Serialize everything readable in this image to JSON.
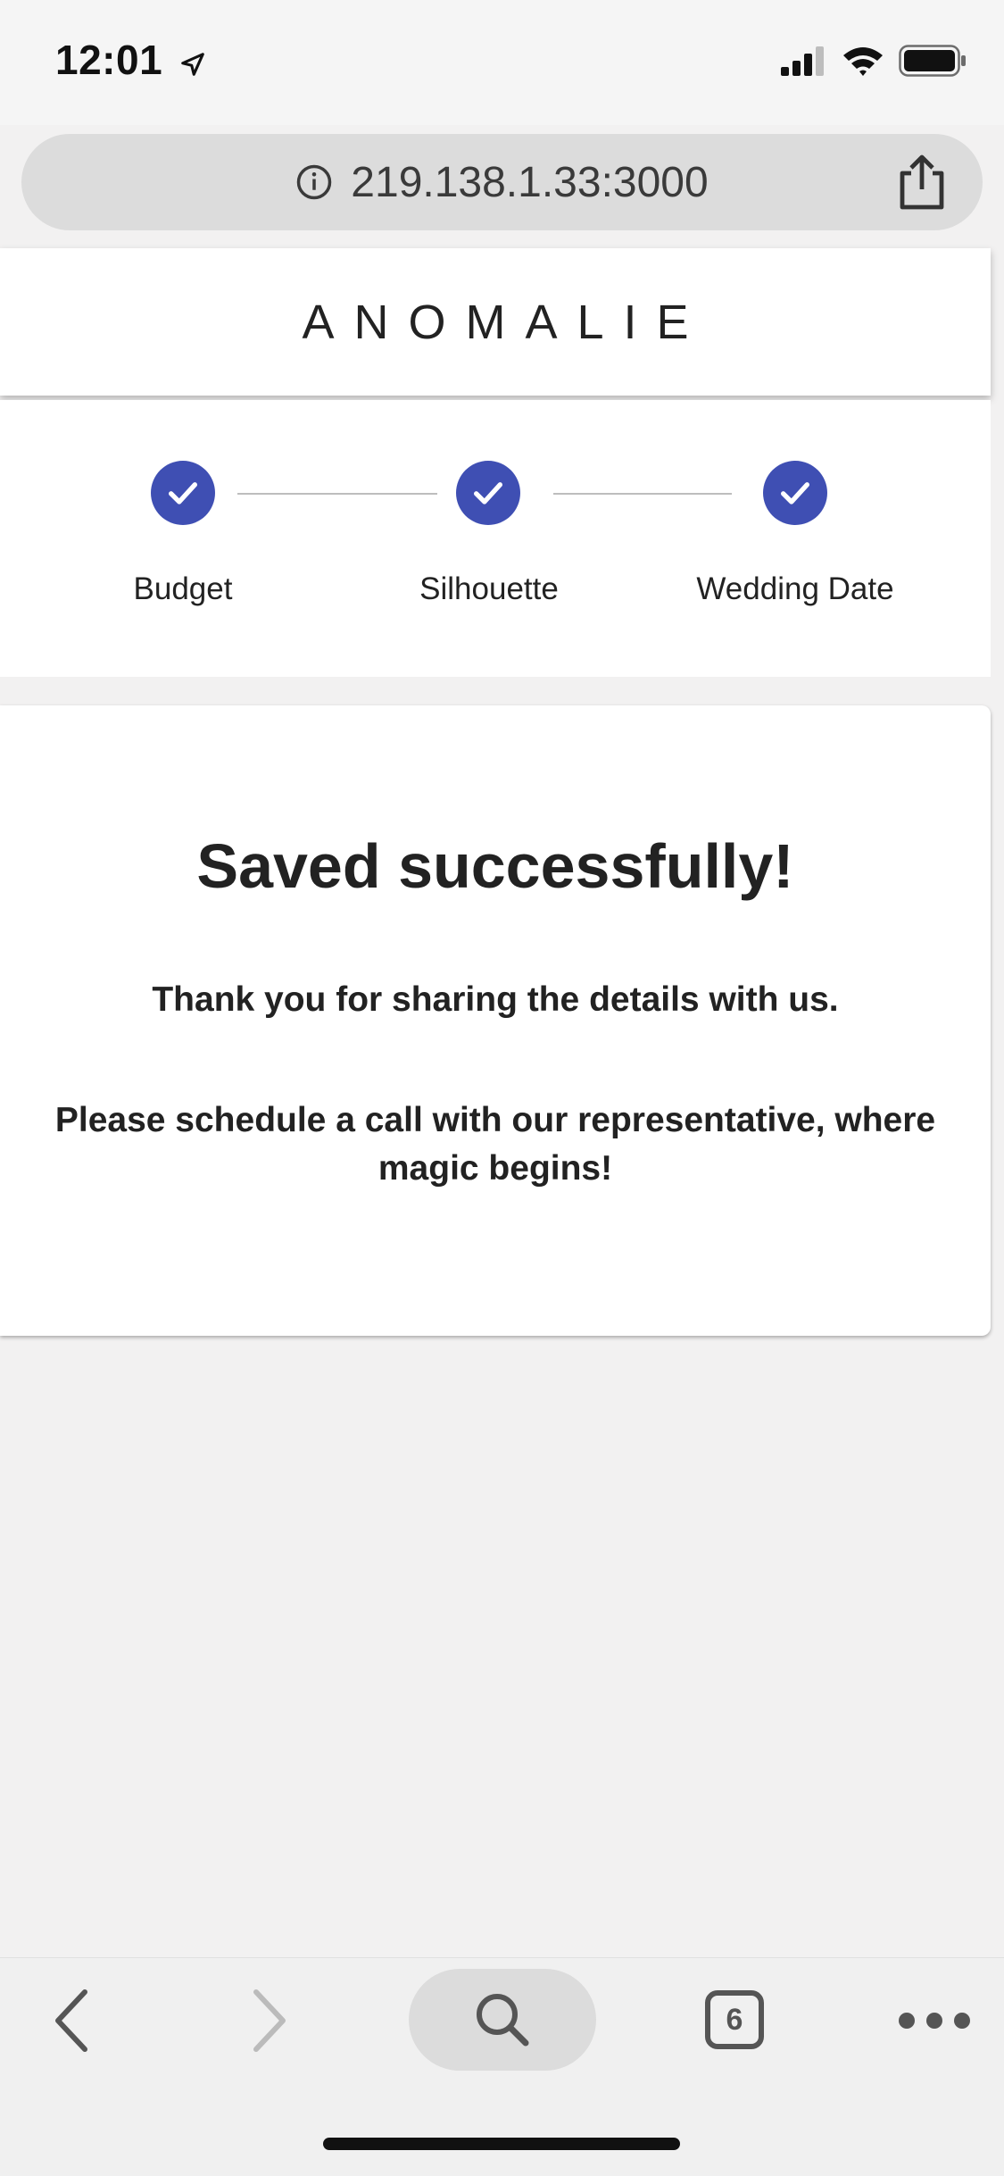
{
  "status_bar": {
    "time": "12:01",
    "icons": [
      "location-arrow-icon",
      "cellular-signal-icon",
      "wifi-icon",
      "battery-icon"
    ]
  },
  "browser": {
    "url": "219.138.1.33:3000",
    "info_icon": "info-icon",
    "share_icon": "share-icon"
  },
  "header": {
    "brand": "ANOMALIE"
  },
  "stepper": {
    "accent_color": "#3f4fb3",
    "steps": [
      {
        "label": "Budget",
        "completed": true
      },
      {
        "label": "Silhouette",
        "completed": true
      },
      {
        "label": "Wedding Date",
        "completed": true
      }
    ]
  },
  "card": {
    "title": "Saved successfully!",
    "thanks": "Thank you for sharing the details with us.",
    "schedule": "Please schedule a call with our representative, where magic begins!"
  },
  "toolbar": {
    "tab_count": "6",
    "icons": [
      "back-arrow-icon",
      "forward-arrow-icon",
      "search-icon",
      "tabs-icon",
      "more-icon"
    ]
  }
}
